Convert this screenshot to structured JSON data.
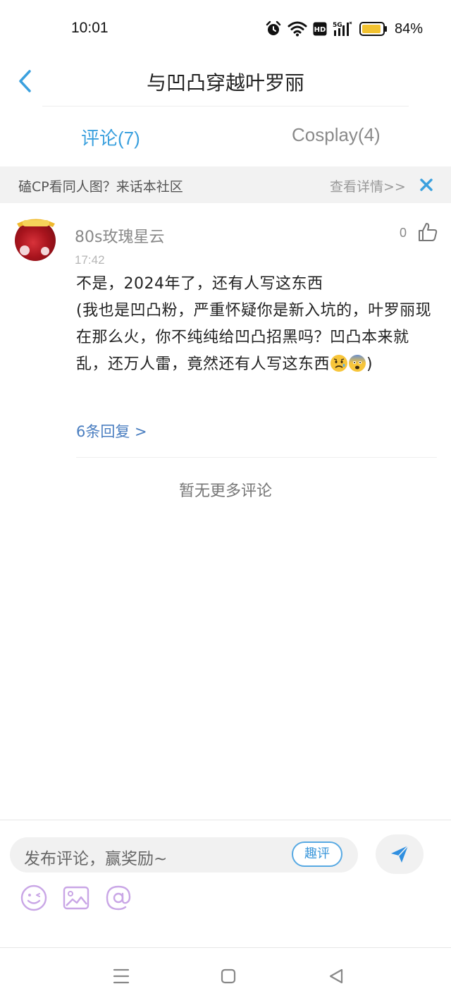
{
  "status_bar": {
    "time": "10:01",
    "battery_percent": "84%",
    "icons": [
      "alarm-icon",
      "wifi-icon",
      "hd-icon",
      "5g-signal-icon",
      "battery-icon"
    ]
  },
  "header": {
    "back_icon": "chevron-left-icon",
    "title": "与凹凸穿越叶罗丽"
  },
  "tabs": [
    {
      "label": "评论(7)",
      "active": true
    },
    {
      "label": "Cosplay(4)",
      "active": false
    }
  ],
  "banner": {
    "text": "磕CP看同人图？来话本社区",
    "link": "查看详情>>",
    "close_icon": "close-icon"
  },
  "comment": {
    "username": "80s玫瑰星云",
    "time": "17:42",
    "like_count": "0",
    "body_text": "不是，2024年了，还有人写这东西\n(我也是凹凸粉，严重怀疑你是新入坑的，叶罗丽现在那么火，你不纯纯给凹凸招黑吗？凹凸本来就乱，还万人雷，竟然还有人写这东西",
    "body_emojis": [
      "sad-face-emoji",
      "fearful-face-emoji"
    ],
    "body_end": ")",
    "replies_link": "6条回复 >"
  },
  "no_more_text": "暂无更多评论",
  "input_bar": {
    "placeholder": "发布评论，赢奖励~",
    "quping_label": "趣评",
    "send_icon": "send-icon",
    "tools": [
      "emoji-icon",
      "image-icon",
      "at-icon"
    ]
  },
  "nav_bar": {
    "buttons": [
      "menu-icon",
      "home-icon",
      "back-triangle-icon"
    ]
  },
  "colors": {
    "accent": "#3aa0de",
    "link": "#4a7ec0",
    "tool_purple": "#c9a6e6"
  }
}
